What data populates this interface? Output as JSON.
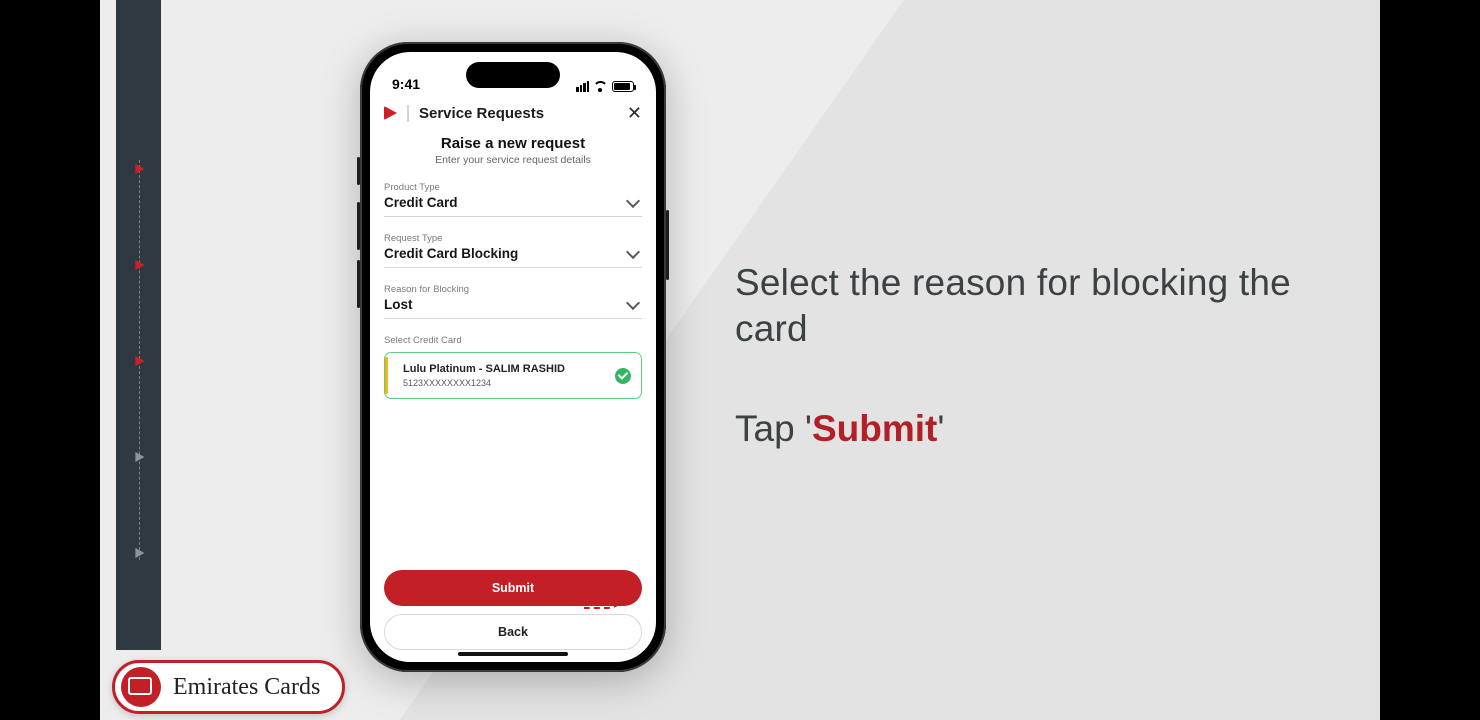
{
  "colors": {
    "accent": "#c21f27",
    "ok": "#33b765"
  },
  "progress": {
    "total": 5,
    "current": 3
  },
  "instruction": {
    "line1": "Select the reason for blocking the card",
    "line2_pre": "Tap '",
    "line2_hl": "Submit",
    "line2_post": "'"
  },
  "phone": {
    "status": {
      "time": "9:41"
    },
    "header": {
      "title": "Service Requests",
      "close": "✕"
    },
    "page": {
      "title": "Raise a new request",
      "subtitle": "Enter your service request details"
    },
    "fields": {
      "product_type": {
        "label": "Product Type",
        "value": "Credit Card"
      },
      "request_type": {
        "label": "Request Type",
        "value": "Credit Card Blocking"
      },
      "reason": {
        "label": "Reason for Blocking",
        "value": "Lost"
      }
    },
    "card_section_label": "Select Credit Card",
    "selected_card": {
      "name": "Lulu Platinum - SALIM RASHID",
      "number": "5123XXXXXXXX1234"
    },
    "buttons": {
      "submit": "Submit",
      "back": "Back"
    }
  },
  "brand": {
    "label": "Emirates Cards"
  }
}
